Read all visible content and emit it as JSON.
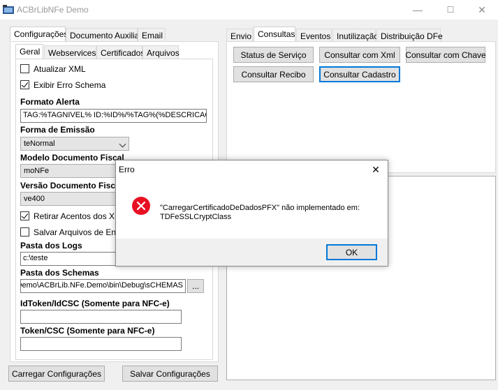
{
  "window": {
    "title": "ACBrLibNFe Demo",
    "minimize": "—",
    "maximize": "☐",
    "close": "✕"
  },
  "left_tabs": [
    "Configurações",
    "Documento Auxiliar",
    "Email"
  ],
  "sub_tabs": [
    "Geral",
    "Webservices",
    "Certificados",
    "Arquivos"
  ],
  "geral": {
    "atualizar_xml": {
      "label": "Atualizar XML",
      "checked": false
    },
    "exibir_erro": {
      "label": "Exibir Erro Schema",
      "checked": true
    },
    "formato_alerta_label": "Formato Alerta",
    "formato_alerta_value": "TAG:%TAGNIVEL% ID:%ID%/%TAG%(%DESCRICAO%",
    "forma_emissao_label": "Forma de Emissão",
    "forma_emissao_value": "teNormal",
    "modelo_label": "Modelo Documento Fiscal",
    "modelo_value": "moNFe",
    "versao_label": "Versão Documento Fiscal",
    "versao_value": "ve400",
    "retirar_acentos": {
      "label": "Retirar Acentos dos XMLs",
      "checked": true
    },
    "salvar_arquivos": {
      "label": "Salvar Arquivos de Envio",
      "checked": false
    },
    "pasta_logs_label": "Pasta dos Logs",
    "pasta_logs_value": "c:\\teste",
    "pasta_schemas_label": "Pasta dos Schemas",
    "pasta_schemas_value": "Demo\\ACBrLib.NFe.Demo\\bin\\Debug\\sCHEMAS",
    "browse_label": "...",
    "idtoken_label": "IdToken/IdCSC (Somente para NFC-e)",
    "idtoken_value": "",
    "token_label": "Token/CSC (Somente para NFC-e)",
    "token_value": ""
  },
  "bottom_buttons": {
    "carregar": "Carregar Configurações",
    "salvar": "Salvar Configurações"
  },
  "right_tabs": [
    "Envio",
    "Consultas",
    "Eventos",
    "Inutilização",
    "Distribuição DFe"
  ],
  "consultas": {
    "status": "Status de Serviço",
    "xml": "Consultar com Xml",
    "chave": "Consultar com Chave",
    "recibo": "Consultar Recibo",
    "cadastro": "Consultar Cadastro"
  },
  "dialog": {
    "title": "Erro",
    "message_line1": "\"CarregarCertificadoDeDadosPFX\" não implementado em:",
    "message_line2": "TDFeSSLCryptClass",
    "ok": "OK",
    "close": "✕",
    "icon": "error-icon",
    "icon_color": "#e81123"
  }
}
